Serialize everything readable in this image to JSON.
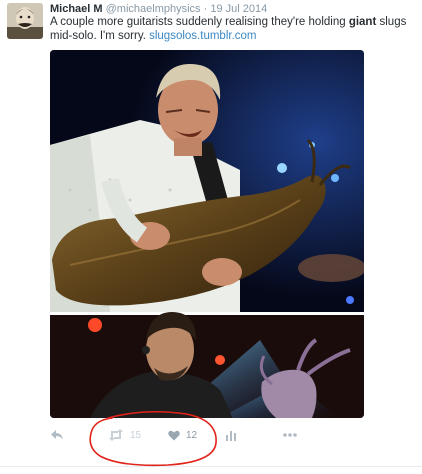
{
  "tweet": {
    "author_name": "Michael M",
    "author_handle": "@michaelmphysics",
    "separator": "·",
    "date": "19 Jul 2014",
    "text_before": "A couple more guitarists suddenly realising they're holding ",
    "text_bold": "giant",
    "text_after": " slugs mid-solo. I'm sorry. ",
    "link": "slugsolos.tumblr.com"
  },
  "actions": {
    "retweet_count": "15",
    "like_count": "12"
  },
  "icons": {
    "reply": "reply-icon",
    "retweet": "retweet-icon",
    "like": "heart-icon",
    "analytics": "analytics-icon",
    "more": "more-icon"
  },
  "colors": {
    "link": "#3b88c3",
    "muted": "#8899a6",
    "action_icon": "#b1bbc3",
    "annotation": "#e0241b"
  }
}
